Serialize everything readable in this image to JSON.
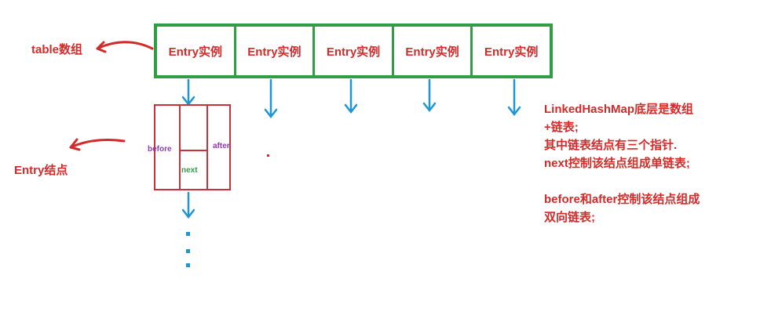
{
  "labels": {
    "table_array": "table数组",
    "entry_node": "Entry结点"
  },
  "entries": [
    "Entry实例",
    "Entry实例",
    "Entry实例",
    "Entry实例",
    "Entry实例"
  ],
  "node": {
    "before": "before",
    "after": "after",
    "next": "next"
  },
  "description": [
    "LinkedHashMap底层是数组",
    "+链表;",
    "其中链表结点有三个指针.",
    "next控制该结点组成单链表;",
    "",
    "before和after控制该结点组成",
    "双向链表;"
  ],
  "colors": {
    "red": "#d42a2a",
    "green": "#2f9e44",
    "blue": "#1e96d6",
    "purple": "#8a3fa8"
  }
}
